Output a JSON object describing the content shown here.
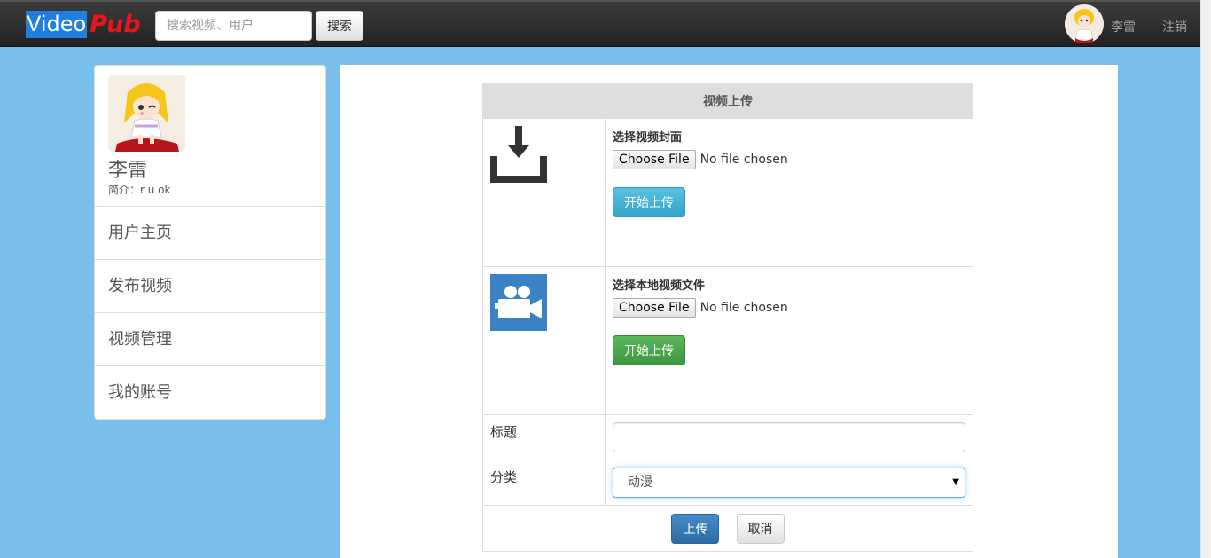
{
  "navbar": {
    "brand_part1": "Video",
    "brand_part2": "Pub",
    "search_placeholder": "搜索视频、用户",
    "search_button": "搜索",
    "username": "李雷",
    "logout": "注销"
  },
  "sidebar": {
    "name": "李雷",
    "bio": "简介：r u ok",
    "items": [
      {
        "label": "用户主页"
      },
      {
        "label": "发布视频"
      },
      {
        "label": "视频管理"
      },
      {
        "label": "我的账号"
      }
    ]
  },
  "upload": {
    "header": "视频上传",
    "cover": {
      "label": "选择视频封面",
      "choose_button": "Choose File",
      "file_status": "No file chosen",
      "upload_button": "开始上传",
      "icon": "download-tray-icon"
    },
    "video": {
      "label": "选择本地视频文件",
      "choose_button": "Choose File",
      "file_status": "No file chosen",
      "upload_button": "开始上传",
      "icon": "video-camera-icon"
    },
    "title_label": "标题",
    "title_value": "",
    "category_label": "分类",
    "category_value": "动漫",
    "submit_button": "上传",
    "cancel_button": "取消"
  },
  "colors": {
    "background": "#79bfec",
    "navbar": "#222222",
    "brand_video_bg": "#1f7ee0",
    "brand_pub": "#e8151b",
    "info": "#5bc0de",
    "success": "#5cb85c",
    "primary": "#428bca"
  }
}
